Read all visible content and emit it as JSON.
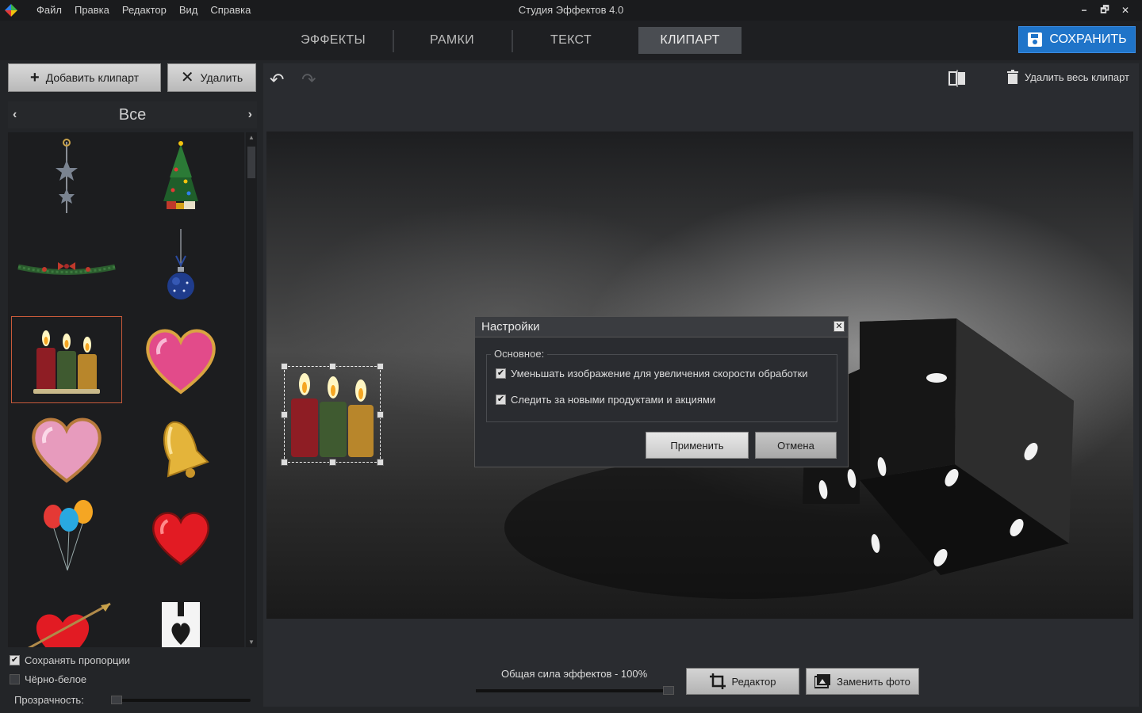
{
  "window": {
    "title": "Студия Эффектов 4.0",
    "menu": [
      "Файл",
      "Правка",
      "Редактор",
      "Вид",
      "Справка"
    ],
    "controls": {
      "minimize": "−",
      "restore": "🗗",
      "close": "✕"
    }
  },
  "tabs": [
    {
      "label": "ЭФФЕКТЫ",
      "active": false
    },
    {
      "label": "РАМКИ",
      "active": false
    },
    {
      "label": "ТЕКСТ",
      "active": false
    },
    {
      "label": "КЛИПАРТ",
      "active": true
    }
  ],
  "save_button": {
    "label": "СОХРАНИТЬ",
    "icon": "floppy-disk-icon",
    "color": "#1f74c9"
  },
  "left_panel": {
    "add_button": "Добавить клипарт",
    "delete_button": "Удалить",
    "category": {
      "prev": "‹",
      "label": "Все",
      "next": "›"
    },
    "clipart": [
      {
        "name": "star-garland",
        "selected": false
      },
      {
        "name": "christmas-tree",
        "selected": false
      },
      {
        "name": "pine-garland",
        "selected": false
      },
      {
        "name": "blue-ornament",
        "selected": false
      },
      {
        "name": "candles",
        "selected": true
      },
      {
        "name": "pink-heart",
        "selected": false
      },
      {
        "name": "pink-heart-outline",
        "selected": false
      },
      {
        "name": "golden-bell",
        "selected": false
      },
      {
        "name": "balloons",
        "selected": false
      },
      {
        "name": "red-heart",
        "selected": false
      },
      {
        "name": "heart-with-arrow",
        "selected": false
      },
      {
        "name": "heart-card",
        "selected": false
      }
    ],
    "options": [
      {
        "label": "Сохранять пропорции",
        "checked": true
      },
      {
        "label": "Чёрно-белое",
        "checked": false
      }
    ],
    "opacity_label": "Прозрачность:",
    "opacity_value": 0
  },
  "workspace": {
    "delete_all": "Удалить весь клипарт",
    "strength_label": "Общая сила эффектов - 100%",
    "strength_value": 100,
    "editor_button": "Редактор",
    "replace_button": "Заменить фото"
  },
  "dialog": {
    "title": "Настройки",
    "group_label": "Основное:",
    "options": [
      {
        "label": "Уменьшать изображение для увеличения скорости обработки",
        "checked": true
      },
      {
        "label": "Следить за новыми продуктами и акциями",
        "checked": true
      }
    ],
    "apply": "Применить",
    "cancel": "Отмена"
  }
}
